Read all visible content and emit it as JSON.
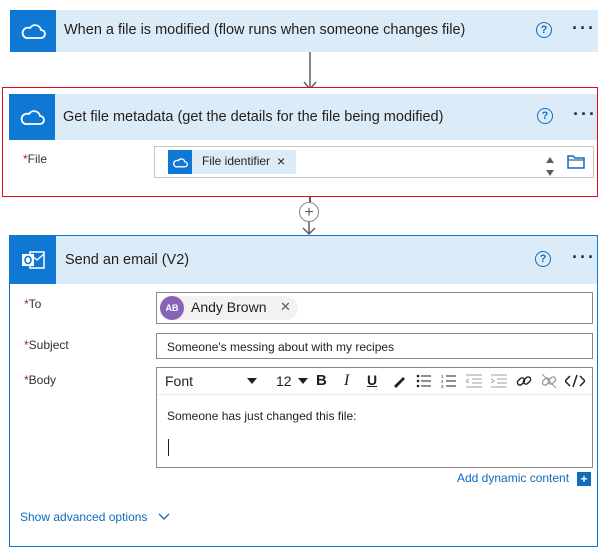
{
  "trigger": {
    "title": "When a file is modified (flow runs when someone changes file)",
    "icon": "onedrive-cloud-icon",
    "help": "?",
    "more": "···"
  },
  "metadata_step": {
    "title": "Get file metadata (get the details for the file being modified)",
    "icon": "onedrive-cloud-icon",
    "help": "?",
    "more": "···",
    "file_label": "File",
    "token_text": "File identifier",
    "token_remove": "×",
    "selected_outline_color": "#e00b1c"
  },
  "connector": {
    "add_symbol": "+"
  },
  "email_step": {
    "title": "Send an email (V2)",
    "icon": "outlook-icon",
    "help": "?",
    "more": "···",
    "to_label": "To",
    "to_person_initials": "AB",
    "to_person_name": "Andy Brown",
    "to_person_remove": "✕",
    "subject_label": "Subject",
    "subject_value": "Someone's messing about with my recipes",
    "body_label": "Body",
    "font_select": "Font",
    "size_select": "12",
    "body_text": "Someone has just changed this file:",
    "add_dynamic": "Add dynamic content",
    "add_dynamic_plus": "+",
    "show_advanced": "Show advanced options"
  },
  "colors": {
    "header_bg": "#dcebf8",
    "icon_bg": "#0f78d4",
    "link": "#0f6cbd",
    "required": "#a4262c"
  }
}
